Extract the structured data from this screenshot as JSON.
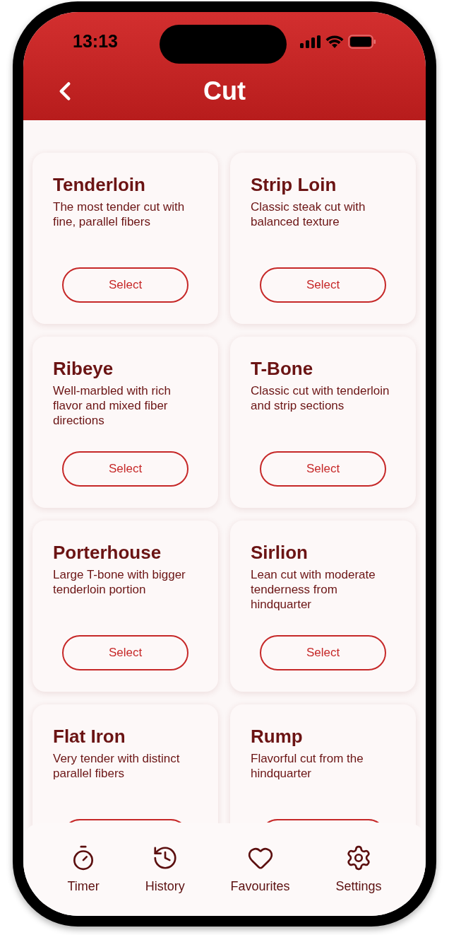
{
  "status_bar": {
    "time": "13:13"
  },
  "header": {
    "title": "Cut"
  },
  "cards": [
    {
      "title": "Tenderloin",
      "description": "The most tender cut with fine, parallel fibers",
      "button": "Select"
    },
    {
      "title": "Strip Loin",
      "description": "Classic steak cut with balanced texture",
      "button": "Select"
    },
    {
      "title": "Ribeye",
      "description": "Well-marbled with rich flavor and mixed fiber directions",
      "button": "Select"
    },
    {
      "title": "T-Bone",
      "description": "Classic cut with tenderloin and strip sections",
      "button": "Select"
    },
    {
      "title": "Porterhouse",
      "description": "Large T-bone with bigger tenderloin portion",
      "button": "Select"
    },
    {
      "title": "Sirlion",
      "description": "Lean cut with moderate tenderness from hindquarter",
      "button": "Select"
    },
    {
      "title": "Flat Iron",
      "description": "Very tender with distinct parallel fibers"
    },
    {
      "title": "Rump",
      "description": "Flavorful cut from the hindquarter"
    }
  ],
  "bottom_nav": [
    {
      "label": "Timer",
      "kind": "timer"
    },
    {
      "label": "History",
      "kind": "history"
    },
    {
      "label": "Favourites",
      "kind": "favourites"
    },
    {
      "label": "Settings",
      "kind": "settings"
    }
  ]
}
